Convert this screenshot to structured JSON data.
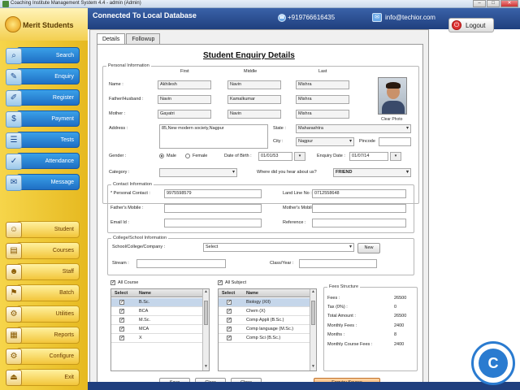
{
  "window": {
    "title": "Coaching Institute Management System 4.4  -  admin (Admin)"
  },
  "brand": {
    "name": "Merit Students"
  },
  "header": {
    "connection": "Connected To Local Database",
    "phone": "+919766616435",
    "email": "info@techior.com",
    "logout": "Logout"
  },
  "sidebar_top": [
    {
      "label": "Search",
      "icon": "search-icon",
      "glyph": "⌕"
    },
    {
      "label": "Enquiry",
      "icon": "enquiry-icon",
      "glyph": "✎"
    },
    {
      "label": "Register",
      "icon": "register-icon",
      "glyph": "✐"
    },
    {
      "label": "Payment",
      "icon": "payment-icon",
      "glyph": "$"
    },
    {
      "label": "Tests",
      "icon": "tests-icon",
      "glyph": "☰"
    },
    {
      "label": "Attendance",
      "icon": "attendance-icon",
      "glyph": "✓"
    },
    {
      "label": "Message",
      "icon": "message-icon",
      "glyph": "✉"
    }
  ],
  "sidebar_bottom": [
    {
      "label": "Student",
      "icon": "student-icon",
      "glyph": "☺"
    },
    {
      "label": "Courses",
      "icon": "courses-icon",
      "glyph": "▤"
    },
    {
      "label": "Staff",
      "icon": "staff-icon",
      "glyph": "☻"
    },
    {
      "label": "Batch",
      "icon": "batch-icon",
      "glyph": "⚑"
    },
    {
      "label": "Utilities",
      "icon": "utilities-icon",
      "glyph": "⚙"
    },
    {
      "label": "Reports",
      "icon": "reports-icon",
      "glyph": "▦"
    },
    {
      "label": "Configure",
      "icon": "configure-icon",
      "glyph": "⚙"
    },
    {
      "label": "Exit",
      "icon": "exit-icon",
      "glyph": "⏏"
    }
  ],
  "tabs": [
    "Details",
    "Followup"
  ],
  "form": {
    "title": "Student Enquiry Details",
    "personal_info": "Personal Information",
    "col_first": "First",
    "col_middle": "Middle",
    "col_last": "Last",
    "name_label": "Name :",
    "name": {
      "first": "Akhilesh",
      "middle": "Navin",
      "last": "Mishra"
    },
    "father_label": "Father/Husband :",
    "father": {
      "first": "Navin",
      "middle": "Kamalkumar",
      "last": "Mishra"
    },
    "mother_label": "Mother :",
    "mother": {
      "first": "Gayatri",
      "middle": "Navin",
      "last": "Mishra"
    },
    "clear_photo": "Clear Photo",
    "address_label": "Address :",
    "address": "85,New modern society,Nagpur",
    "state_label": "State :",
    "state": "Maharashtra",
    "city_label": "City :",
    "city": "Nagpur",
    "pincode_label": "Pincode",
    "gender_label": "Gender :",
    "gender_male": "Male",
    "gender_female": "Female",
    "dob_label": "Date of Birth :",
    "dob": "01/01/53",
    "enquiry_date_label": "Enquiry Date :",
    "enquiry_date": "01/07/14",
    "category_label": "Category :",
    "hear_label": "Where did you hear about us?",
    "hear_value": "FRIEND",
    "contact_info": "Contact Information",
    "personal_contact_label": "* Personal Contact :",
    "personal_contact": "9975598579",
    "landline_label": "Land Line No :",
    "landline": "0712558648",
    "father_mobile_label": "Father's Mobile :",
    "mother_mobile_label": "Mother's Mobile :",
    "email_label": "Email Id :",
    "reference_label": "Reference :",
    "college_info": "College/School Information",
    "college_label": "School/College/Company :",
    "college_value": "Select",
    "new_btn": "New",
    "stream_label": "Stream :",
    "class_label": "Class/Year :"
  },
  "courses": {
    "all_label": "All Course",
    "head_select": "Select",
    "head_name": "Name",
    "rows": [
      "B.Sc.",
      "BCA",
      "M.Sc.",
      "MCA",
      "X"
    ]
  },
  "subjects": {
    "all_label": "All Subject",
    "head_select": "Select",
    "head_name": "Name",
    "rows": [
      "Biology (XII)",
      "Chem (X)",
      "Comp Appli (B.Sc.)",
      "Comp language (M.Sc.)",
      "Comp Sci (B.Sc.)"
    ]
  },
  "fees": {
    "title": "Fees Structure",
    "rows": [
      {
        "k": "Fees :",
        "v": "26500"
      },
      {
        "k": "Tax (0%) :",
        "v": "0"
      },
      {
        "k": "Total Amount :",
        "v": "26500"
      },
      {
        "k": "Monthly Fees :",
        "v": "2400"
      },
      {
        "k": "Months :",
        "v": "8"
      },
      {
        "k": "Monthly Course Fees :",
        "v": "2400"
      }
    ]
  },
  "buttons": {
    "save": "Save",
    "clear": "Clear",
    "close": "Close",
    "enquiry_source": "Enquiry Source"
  }
}
